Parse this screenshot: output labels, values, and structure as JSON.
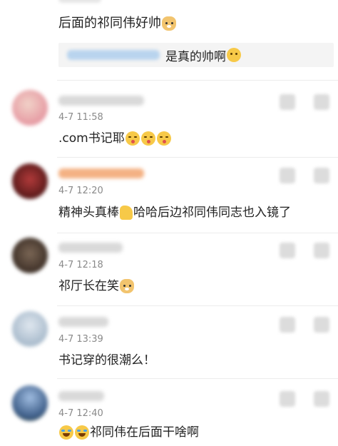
{
  "top_comment": {
    "text": "后面的祁同伟好帅",
    "emoji": "doge-emoji",
    "reply": {
      "text": "是真的帅啊",
      "emoji": "thinking-emoji"
    }
  },
  "comments": [
    {
      "time": "4-7 11:58",
      "text": ".com书记耶",
      "emojis": [
        "kiss-emoji",
        "kiss-emoji",
        "kiss-emoji"
      ],
      "avatar_color": "#e8b3b8",
      "name_color": "#d9d9d9"
    },
    {
      "time": "4-7 12:20",
      "text_before": "精神头真棒",
      "text_after": " 哈哈后边祁同伟同志也入镜了",
      "emojis": [
        "thumbs-up-emoji"
      ],
      "avatar_color": "#8a2a2a",
      "name_color": "#f4b183"
    },
    {
      "time": "4-7 12:18",
      "text": "祁厅长在笑",
      "emojis": [
        "doge-emoji"
      ],
      "avatar_color": "#5b4a3a",
      "name_color": "#d9d9d9"
    },
    {
      "time": "4-7 13:39",
      "text": "书记穿的很潮么！",
      "emojis": [],
      "avatar_color": "#c7d3e0",
      "name_color": "#d9d9d9"
    },
    {
      "time": "4-7 12:40",
      "text": "祁同伟在后面干啥啊",
      "emojis": [
        "laughing-emoji",
        "laughing-emoji"
      ],
      "avatar_color": "#3f5f8a",
      "name_color": "#d9d9d9"
    }
  ]
}
